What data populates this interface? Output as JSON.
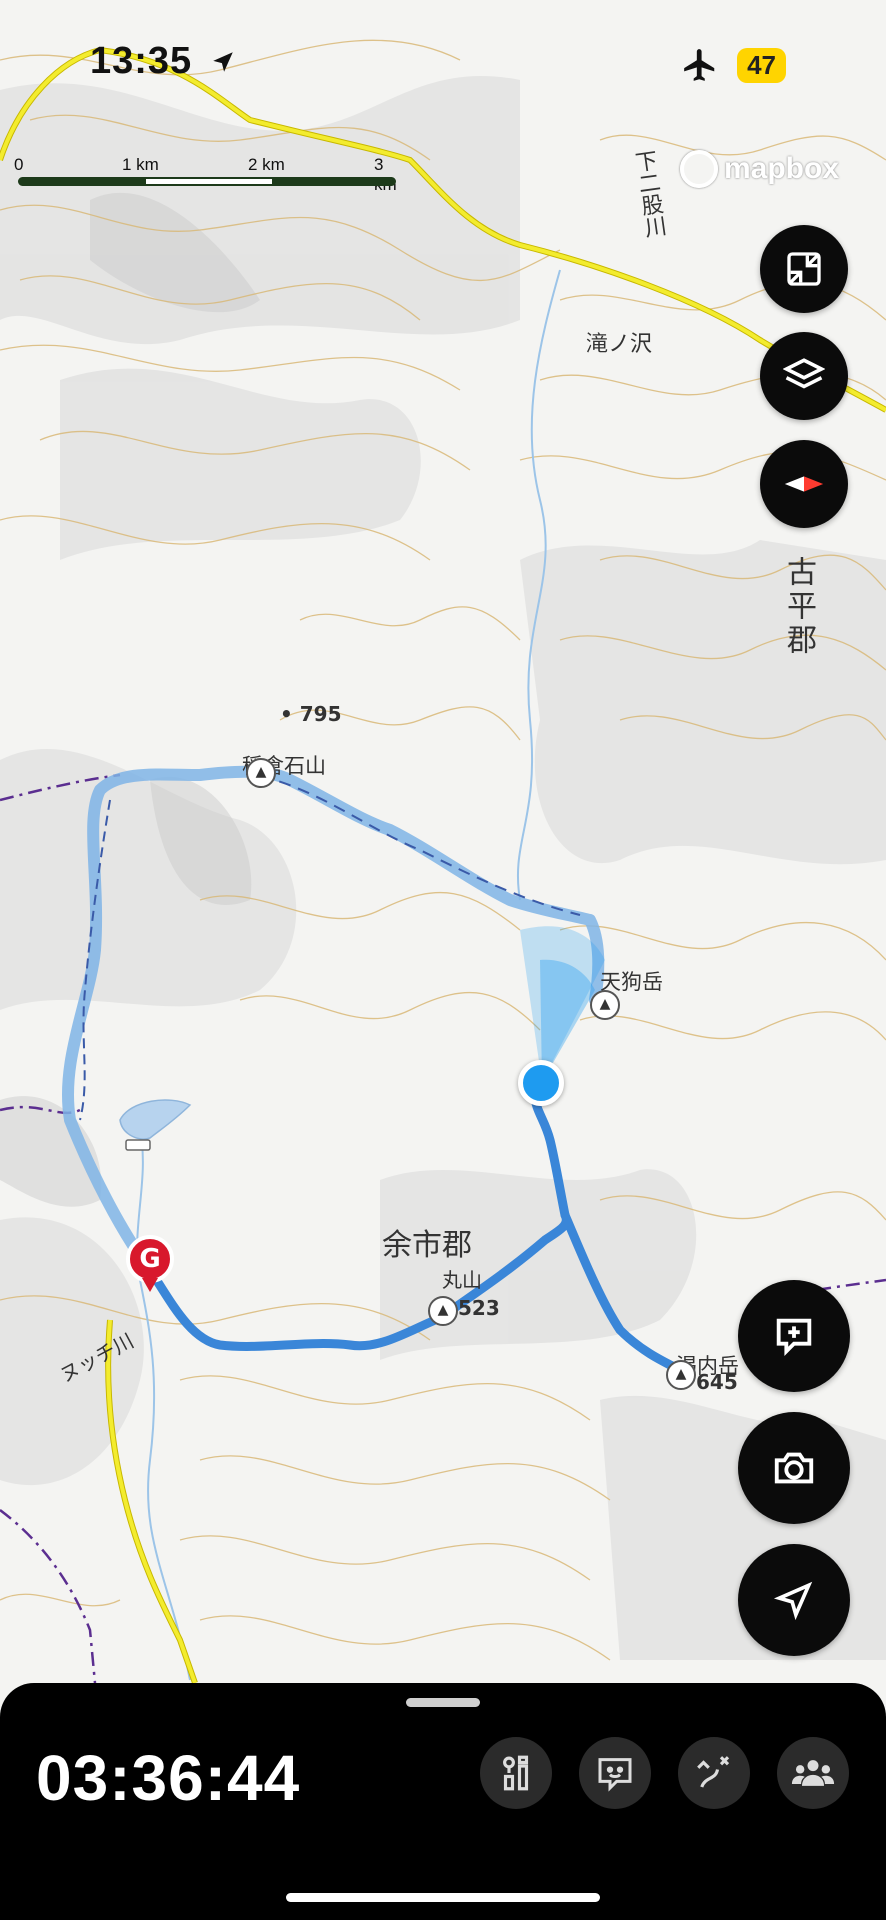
{
  "status_bar": {
    "time": "13:35",
    "battery": "47"
  },
  "scale": {
    "labels": [
      "0",
      "1 km",
      "2 km",
      "3 km"
    ]
  },
  "attribution": "mapbox",
  "map_labels": {
    "river_top": "下二股川",
    "takinosawa": "滝ノ沢",
    "district_east": "古平郡",
    "elevation_795": "795",
    "inakura": "稲倉石山",
    "tengu": "天狗岳",
    "yoichi": "余市郡",
    "maruyama": "丸山",
    "maruyama_elev": "523",
    "katanai": "渇内岳",
    "katanai_elev": "645",
    "nuttsu_river": "ヌッチ川",
    "goal_marker": "G"
  },
  "controls": {
    "collapse_icon": "collapse-icon",
    "layers_icon": "layers-icon",
    "compass_icon": "compass-icon",
    "add_note_icon": "add-note-icon",
    "camera_icon": "camera-icon",
    "locate_icon": "location-arrow-icon"
  },
  "bottom_panel": {
    "elapsed_time": "03:36:44",
    "tools": [
      "route-info-icon",
      "chat-face-icon",
      "route-plan-icon",
      "group-icon"
    ]
  },
  "colors": {
    "route": "#3a86d8",
    "track": "#7fb4e6",
    "road": "#f0e623",
    "accent": "#ff3b30",
    "location": "#1e9bf0"
  }
}
